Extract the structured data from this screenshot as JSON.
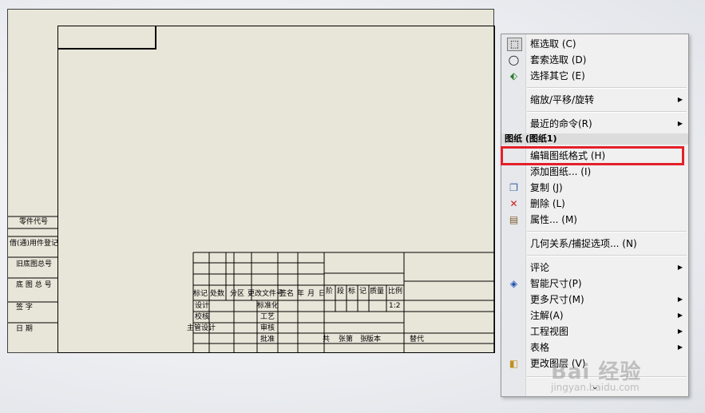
{
  "title_block": {
    "left_labels": [
      "零件代号",
      "借(通)用件登记",
      "旧底图总号",
      "底 图 总 号",
      "签    字",
      "日    期"
    ],
    "header_labels": [
      "标记",
      "处数",
      "分区",
      "更改文件号",
      "签名",
      "年",
      "月",
      "日"
    ],
    "row_labels": [
      "设计",
      "标准化",
      "校核",
      "工艺",
      "主管设计",
      "审核",
      "批准"
    ],
    "stage_labels": [
      "阶",
      "段",
      "标",
      "记",
      "质量",
      "比例"
    ],
    "scale": "1:2",
    "bottom_labels": [
      "共",
      "张第",
      "张",
      "版本",
      "替代"
    ]
  },
  "menu": {
    "items": [
      {
        "label": "框选取 (C)",
        "icon": "box-select-icon",
        "glyph": "⬚"
      },
      {
        "label": "套索选取 (D)",
        "icon": "lasso-icon",
        "glyph": "◯"
      },
      {
        "label": "选择其它 (E)",
        "icon": "select-other-icon",
        "glyph": "⬖"
      },
      {
        "label": "缩放/平移/旋转",
        "icon": "",
        "glyph": "",
        "submenu": true
      },
      {
        "label": "最近的命令(R)",
        "icon": "",
        "glyph": "",
        "submenu": true
      },
      {
        "label": "编辑图纸格式 (H)",
        "icon": "",
        "glyph": ""
      },
      {
        "label": "添加图纸... (I)",
        "icon": "",
        "glyph": ""
      },
      {
        "label": "复制 (J)",
        "icon": "copy-icon",
        "glyph": "❐"
      },
      {
        "label": "删除 (L)",
        "icon": "delete-icon",
        "glyph": "✕"
      },
      {
        "label": "属性... (M)",
        "icon": "properties-icon",
        "glyph": "▤"
      },
      {
        "label": "几何关系/捕捉选项... (N)",
        "icon": "",
        "glyph": ""
      },
      {
        "label": "评论",
        "icon": "",
        "glyph": "",
        "submenu": true
      },
      {
        "label": "智能尺寸(P)",
        "icon": "smart-dimension-icon",
        "glyph": "◈"
      },
      {
        "label": "更多尺寸(M)",
        "icon": "",
        "glyph": "",
        "submenu": true
      },
      {
        "label": "注解(A)",
        "icon": "",
        "glyph": "",
        "submenu": true
      },
      {
        "label": "工程视图",
        "icon": "",
        "glyph": "",
        "submenu": true
      },
      {
        "label": "表格",
        "icon": "",
        "glyph": "",
        "submenu": true
      },
      {
        "label": "更改图层 (V)",
        "icon": "layer-icon",
        "glyph": "◧"
      }
    ],
    "section_title": "图纸 (图纸1)",
    "more_glyph": "⌄"
  },
  "watermark": {
    "text": "Bai 经验",
    "sub": "jingyan.baidu.com"
  },
  "colors": {
    "highlight": "#e4202a",
    "sheet": "#e8e6d9"
  }
}
